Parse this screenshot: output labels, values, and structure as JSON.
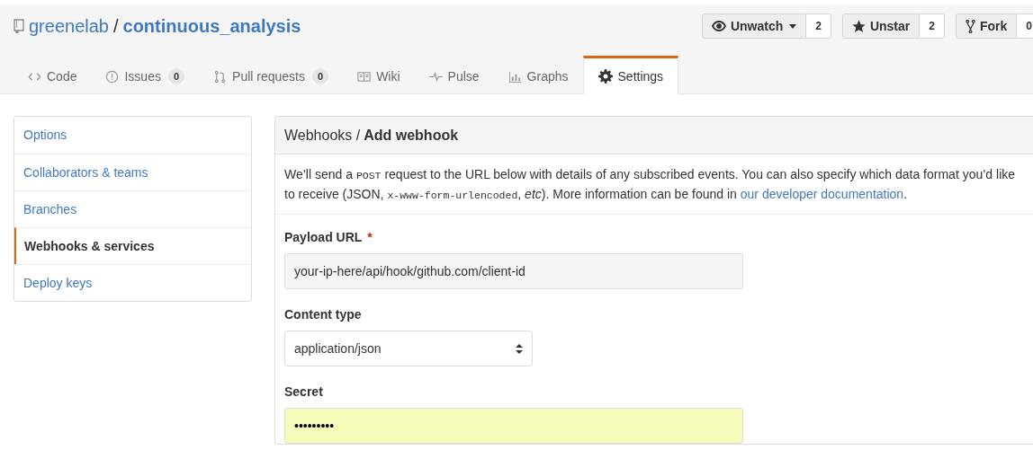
{
  "repo": {
    "owner": "greenelab",
    "separator": "/",
    "name": "continuous_analysis"
  },
  "actions": [
    {
      "kind": "watch",
      "label": "Unwatch",
      "count": "2"
    },
    {
      "kind": "star",
      "label": "Unstar",
      "count": "2"
    },
    {
      "kind": "fork",
      "label": "Fork",
      "count": "0"
    }
  ],
  "tabs": [
    {
      "kind": "code",
      "label": "Code",
      "selected": false
    },
    {
      "kind": "issues",
      "label": "Issues",
      "count": "0",
      "selected": false
    },
    {
      "kind": "pulls",
      "label": "Pull requests",
      "count": "0",
      "selected": false
    },
    {
      "kind": "wiki",
      "label": "Wiki",
      "selected": false
    },
    {
      "kind": "pulse",
      "label": "Pulse",
      "selected": false
    },
    {
      "kind": "graphs",
      "label": "Graphs",
      "selected": false
    },
    {
      "kind": "settings",
      "label": "Settings",
      "selected": true
    }
  ],
  "sidebar": {
    "items": [
      {
        "label": "Options",
        "selected": false
      },
      {
        "label": "Collaborators & teams",
        "selected": false
      },
      {
        "label": "Branches",
        "selected": false
      },
      {
        "label": "Webhooks & services",
        "selected": true
      },
      {
        "label": "Deploy keys",
        "selected": false
      }
    ]
  },
  "panel": {
    "breadcrumb": "Webhooks /",
    "title": "Add webhook",
    "description": [
      {
        "kind": "text",
        "text": "We’ll send a "
      },
      {
        "kind": "code",
        "text": "POST"
      },
      {
        "kind": "text",
        "text": " request to the URL below with details of any subscribed events. You can also specify which data format you’d like to receive (JSON, "
      },
      {
        "kind": "code",
        "text": "x-www-form-urlencoded"
      },
      {
        "kind": "text",
        "text": ", "
      },
      {
        "kind": "em",
        "text": "etc"
      },
      {
        "kind": "text",
        "text": "). More information can be found in "
      },
      {
        "kind": "link",
        "text": "our developer documentation"
      },
      {
        "kind": "text",
        "text": "."
      }
    ],
    "fields": [
      {
        "kind": "text",
        "label": "Payload URL",
        "required_mark": "*",
        "value": "your-ip-here/api/hook/github.com/client-id"
      },
      {
        "kind": "select",
        "label": "Content type",
        "value": "application/json"
      },
      {
        "kind": "secret",
        "label": "Secret",
        "value": "•••••••••"
      }
    ]
  }
}
